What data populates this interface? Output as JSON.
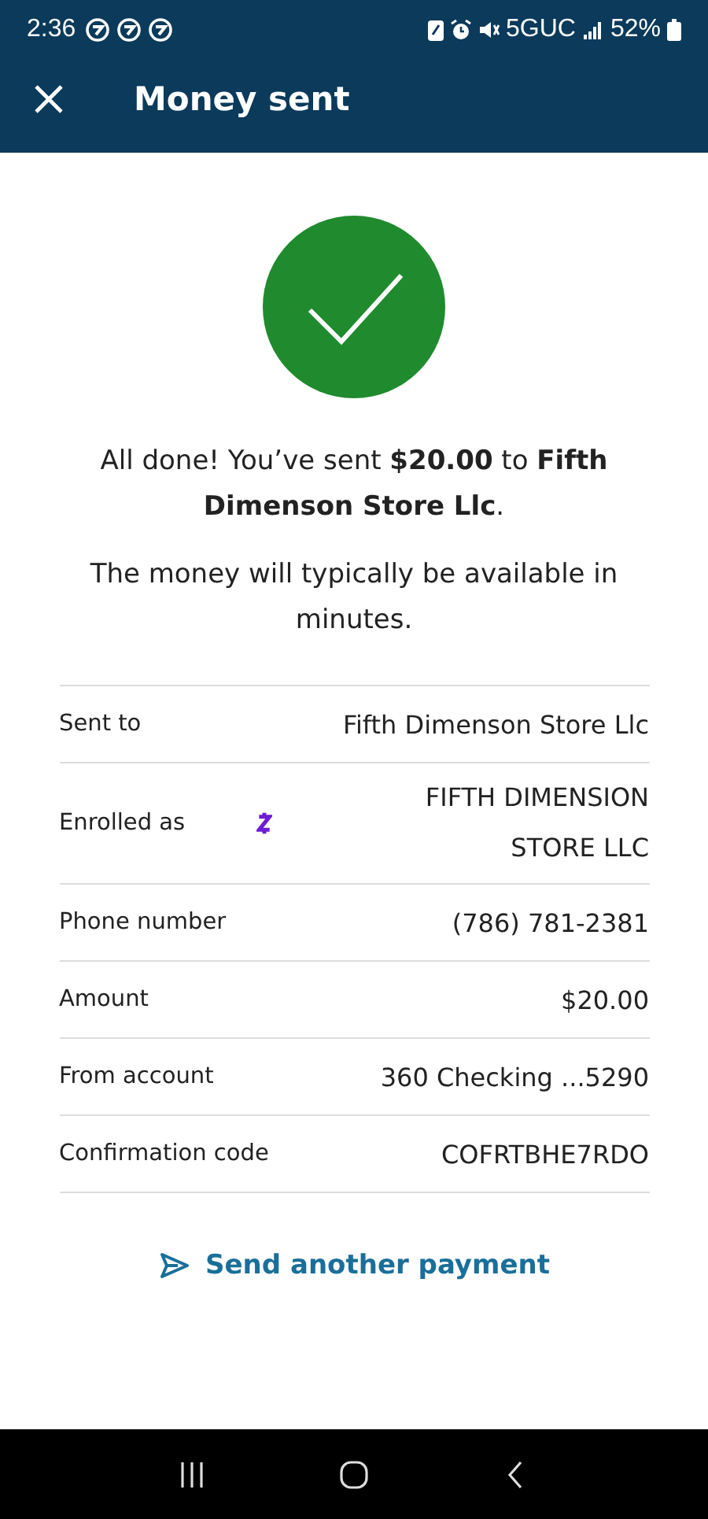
{
  "status_bar": {
    "time": "2:36",
    "network": "5GUC",
    "battery": "52%"
  },
  "header": {
    "title": "Money sent"
  },
  "message": "All done! You’ve sent **$20.00** to **Fifth Dimenson Store Llc**.",
  "note": "The money will typically be available in minutes.",
  "details": [
    {
      "kind": "plain",
      "label": "Sent to",
      "value": "Fifth Dimenson Store Llc"
    },
    {
      "kind": "enrolled",
      "label": "Enrolled as",
      "value": "FIFTH DIMENSION STORE LLC"
    },
    {
      "kind": "plain",
      "label": "Phone number",
      "value": "(786) 781-2381"
    },
    {
      "kind": "plain",
      "label": "Amount",
      "value": "$20.00"
    },
    {
      "kind": "plain",
      "label": "From account",
      "value": "360 Checking ...5290"
    },
    {
      "kind": "plain",
      "label": "Confirmation code",
      "value": "COFRTBHE7RDO"
    }
  ],
  "action": {
    "label": "Send another payment"
  }
}
